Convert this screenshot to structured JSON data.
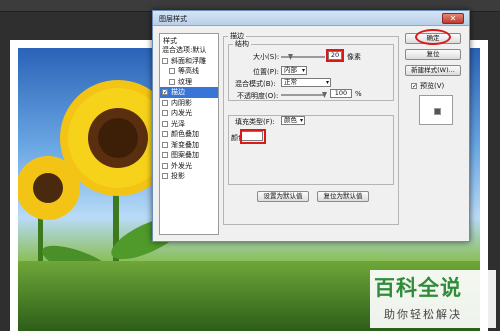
{
  "dialog": {
    "title": "图层样式",
    "close_glyph": "✕"
  },
  "style_list": {
    "header": "样式",
    "items": [
      {
        "label": "混合选项:默认",
        "checkbox": false,
        "checked": false,
        "indent": false,
        "selected": false
      },
      {
        "label": "斜面和浮雕",
        "checkbox": true,
        "checked": false,
        "indent": false,
        "selected": false
      },
      {
        "label": "等高线",
        "checkbox": true,
        "checked": false,
        "indent": true,
        "selected": false
      },
      {
        "label": "纹理",
        "checkbox": true,
        "checked": false,
        "indent": true,
        "selected": false
      },
      {
        "label": "描边",
        "checkbox": true,
        "checked": true,
        "indent": false,
        "selected": true
      },
      {
        "label": "内阴影",
        "checkbox": true,
        "checked": false,
        "indent": false,
        "selected": false
      },
      {
        "label": "内发光",
        "checkbox": true,
        "checked": false,
        "indent": false,
        "selected": false
      },
      {
        "label": "光泽",
        "checkbox": true,
        "checked": false,
        "indent": false,
        "selected": false
      },
      {
        "label": "颜色叠加",
        "checkbox": true,
        "checked": false,
        "indent": false,
        "selected": false
      },
      {
        "label": "渐变叠加",
        "checkbox": true,
        "checked": false,
        "indent": false,
        "selected": false
      },
      {
        "label": "图案叠加",
        "checkbox": true,
        "checked": false,
        "indent": false,
        "selected": false
      },
      {
        "label": "外发光",
        "checkbox": true,
        "checked": false,
        "indent": false,
        "selected": false
      },
      {
        "label": "投影",
        "checkbox": true,
        "checked": false,
        "indent": false,
        "selected": false
      }
    ]
  },
  "stroke": {
    "section_title": "描边",
    "structure_title": "结构",
    "size_label": "大小(S):",
    "size_value": "20",
    "size_unit": "像素",
    "size_level": 0.2,
    "position_label": "位置(P):",
    "position_value": "内部",
    "blend_label": "混合模式(B):",
    "blend_value": "正常",
    "opacity_label": "不透明度(O):",
    "opacity_value": "100",
    "opacity_unit": "%",
    "fill_type_label": "填充类型(F):",
    "fill_type_value": "颜色",
    "color_label": "颜色:",
    "set_default_button": "设置为默认值",
    "reset_default_button": "复位为默认值"
  },
  "actions": {
    "ok": "确定",
    "reset": "复位",
    "new_style": "新建样式(W)...",
    "preview_label": "预览(V)",
    "preview_checked": true
  },
  "watermark": {
    "main": "百科全说",
    "sub": "助你轻松解决"
  },
  "colors": {
    "highlight_red": "#d71a1a",
    "selection_blue": "#3875d7",
    "watermark_green": "#2f8c3a"
  }
}
